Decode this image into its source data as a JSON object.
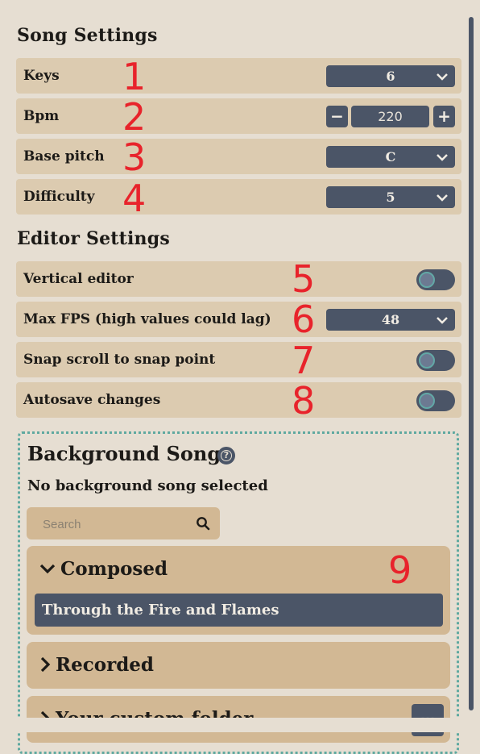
{
  "song_settings": {
    "title": "Song Settings",
    "keys": {
      "label": "Keys",
      "value": "6"
    },
    "bpm": {
      "label": "Bpm",
      "value": "220",
      "decrement": "−",
      "increment": "+"
    },
    "base_pitch": {
      "label": "Base pitch",
      "value": "C"
    },
    "difficulty": {
      "label": "Difficulty",
      "value": "5"
    }
  },
  "editor_settings": {
    "title": "Editor Settings",
    "vertical_editor": {
      "label": "Vertical editor",
      "enabled": false
    },
    "max_fps": {
      "label": "Max FPS (high values could lag)",
      "value": "48"
    },
    "snap_scroll": {
      "label": "Snap scroll to snap point",
      "enabled": false
    },
    "autosave": {
      "label": "Autosave changes",
      "enabled": false
    }
  },
  "background_song": {
    "title": "Background Song",
    "status": "No background song selected",
    "search": {
      "placeholder": "Search",
      "value": ""
    },
    "folders": [
      {
        "name": "Composed",
        "expanded": true,
        "songs": [
          "Through the Fire and Flames"
        ]
      },
      {
        "name": "Recorded",
        "expanded": false,
        "songs": []
      },
      {
        "name": "Your custom folder",
        "expanded": false,
        "songs": [],
        "menu_label": "..."
      }
    ]
  },
  "annotations": [
    "1",
    "2",
    "3",
    "4",
    "5",
    "6",
    "7",
    "8",
    "9"
  ],
  "colors": {
    "background": "#e6ded2",
    "row": "#dccbb0",
    "control": "#4b5567",
    "accent_dotted": "#5fa9a0",
    "annotation": "#e8232b"
  }
}
